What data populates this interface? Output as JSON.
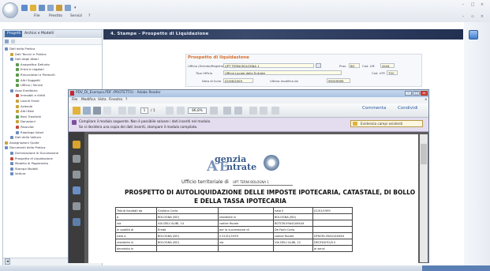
{
  "app": {
    "title": "",
    "menu": [
      "File",
      "Prestito",
      "Servizi",
      "?"
    ]
  },
  "left_panel": {
    "tabs": [
      "Progetti",
      "Archivi e Modelli"
    ],
    "tree": [
      {
        "level": 0,
        "label": "Dati della Pratica",
        "color": "#6b8cc2"
      },
      {
        "level": 1,
        "label": "Dati Tecnici e Pratica",
        "color": "#c9a33a"
      },
      {
        "level": 1,
        "label": "Dati degli Attori",
        "color": "#6b8cc2"
      },
      {
        "level": 2,
        "label": "Anagrafica Defunto",
        "color": "#5c9a4c"
      },
      {
        "level": 2,
        "label": "Eredi e Legatari",
        "color": "#5c9a4c"
      },
      {
        "level": 2,
        "label": "Rinunciatari e Premorti",
        "color": "#5c9a4c"
      },
      {
        "level": 2,
        "label": "Altri Soggetti",
        "color": "#5c9a4c"
      },
      {
        "level": 2,
        "label": "Ufficio / Servizi",
        "color": "#5c9a4c"
      },
      {
        "level": 1,
        "label": "Asse Ereditario",
        "color": "#6b8cc2"
      },
      {
        "level": 2,
        "label": "Immobili e diritti",
        "color": "#c24a3c"
      },
      {
        "level": 2,
        "label": "Lasciti Fondi",
        "color": "#c9a33a"
      },
      {
        "level": 2,
        "label": "Aziende",
        "color": "#c9a33a"
      },
      {
        "level": 2,
        "label": "Altri Beni",
        "color": "#c9a33a"
      },
      {
        "level": 2,
        "label": "Beni Trasferiti",
        "color": "#5c9a4c"
      },
      {
        "level": 2,
        "label": "Donazioni",
        "color": "#c9a33a"
      },
      {
        "level": 2,
        "label": "Passività",
        "color": "#c24a3c"
      },
      {
        "level": 2,
        "label": "Riepilogo Valori",
        "color": "#6b8cc2"
      },
      {
        "level": 1,
        "label": "Dati della Voltura",
        "color": "#6b8cc2"
      },
      {
        "level": 0,
        "label": "Assegnazioni Quote",
        "color": "#c9a33a"
      },
      {
        "level": 0,
        "label": "Documenti della Pratica",
        "color": "#6b8cc2"
      },
      {
        "level": 1,
        "label": "Dichiarazione di Successione",
        "color": "#6b8cc2"
      },
      {
        "level": 1,
        "label": "Prospetto di Liquidazione",
        "color": "#c24a3c"
      },
      {
        "level": 1,
        "label": "Modello di Pagamento",
        "color": "#6b8cc2"
      },
      {
        "level": 1,
        "label": "Stampa Modelli",
        "color": "#6b8cc2"
      },
      {
        "level": 1,
        "label": "Voltura",
        "color": "#6b8cc2"
      }
    ]
  },
  "main": {
    "header_title": "4. Stampe - Prospetto di Liquidazione",
    "form": {
      "title": "Prospetto di liquidazione",
      "ufficio_label": "Ufficio (Entrate/Registro)",
      "ufficio_value": "UPT TERNI BOLOGNA 1",
      "tipo_ufficio_label": "Tipo Ufficio",
      "tipo_ufficio_value": "Ufficio Locale delle Entrate",
      "prov_label": "Prov.",
      "prov_value": "BO",
      "cod_uff_label": "Cod. Uff.",
      "cod_uff_value": "4444",
      "cod_label": "Cod. UFF.",
      "cod_value": "TQC",
      "data_label": "Data di Invio",
      "data_value": "02/06/2009",
      "ultima_label": "Ultima modifica da",
      "ultima_value": "99/9/9999"
    }
  },
  "pdf": {
    "window_title": "PDV_DI_Esempio.PDF (PROTETTO) - Adobe Reader",
    "menu": [
      "File",
      "Modifica",
      "Vista",
      "Finestra",
      "?"
    ],
    "page_current": "1",
    "page_total": "/ 1",
    "zoom": "86,8%",
    "commenta": "Commenta",
    "condividi": "Condividi",
    "message_line1": "Compilare il modulo seguente. Non è possibile salvare i dati inseriti nel modulo.",
    "message_line2": "Se si desidera una copia dei dati inseriti, stampare il modulo compilato.",
    "highlight_button": "Evidenzia campi esistenti",
    "document": {
      "logo_line1": "genzia",
      "logo_line2": "ntrate",
      "logo_letter_a": "A",
      "logo_letter_e": "E",
      "ufficio_label": "Ufficio territoriale di",
      "ufficio_value": "UPT TERNI BOLOGNA 1",
      "title_line1": "PROSPETTO DI AUTOLIQUIDAZIONE DELLE IMPOSTE IPOTECARIA, CATASTALE, DI BOLLO",
      "title_line2": "E DELLA TASSA IPOTECARIA",
      "table": [
        [
          "Tributi liquidati da",
          "Giuliano Carla",
          "",
          "nato il",
          "01/01/1959"
        ],
        [
          "a",
          "BOLOGNA (BO)",
          "residente in",
          "BOLOGNA (BO)",
          ""
        ],
        [
          "via",
          "VIA DELL'ALIBI, 14",
          "codice fiscale",
          "BGTCRL59A41A944X",
          ""
        ],
        [
          "in qualità di",
          "Erede",
          "per la successione di",
          "De Fanti Carlo",
          ""
        ],
        [
          "nato a",
          "BOLOGNA (BO)",
          "il 01/01/1939",
          "codice fiscale",
          "DFNCRL39A01A944H"
        ],
        [
          "residente in",
          "BOLOGNA (BO)",
          "via",
          "VIA DELL'ALIBI, 12",
          "DECEDUTO/A il"
        ],
        [
          "deceduto in",
          "",
          "",
          "",
          "ai sensi"
        ]
      ]
    }
  },
  "colors": {
    "header": "#2b3956",
    "accent_orange": "#d96d2a",
    "message_bar": "#e4dcef",
    "pdf_gray": "#5c5c5c",
    "logo_blue": "#3a5a8a"
  }
}
